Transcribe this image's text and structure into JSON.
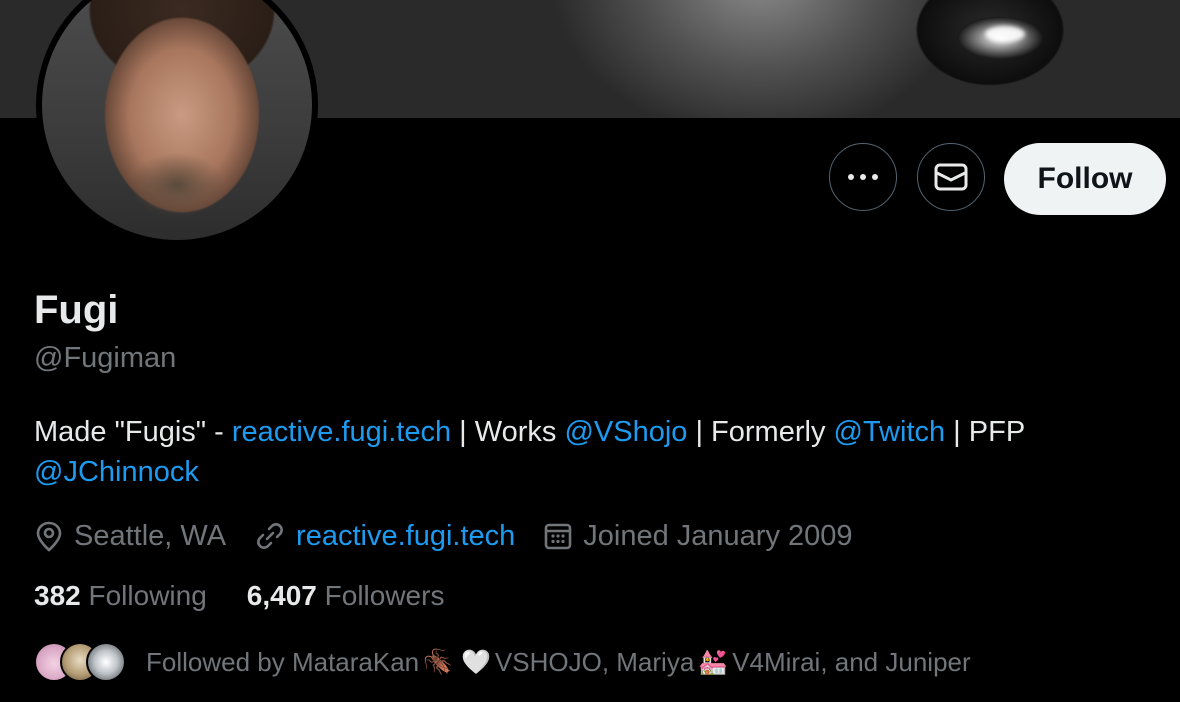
{
  "profile": {
    "name": "Fugi",
    "handle": "@Fugiman",
    "bio": {
      "t1": "Made \"Fugis\" - ",
      "l1": "reactive.fugi.tech",
      "t2": " | Works ",
      "l2": "@VShojo",
      "t3": " | Formerly ",
      "l3": "@Twitch",
      "t4": " | PFP ",
      "l4": "@JChinnock"
    },
    "location": "Seattle, WA",
    "website": "reactive.fugi.tech",
    "joined": "Joined January 2009",
    "following_count": "382",
    "following_label": "Following",
    "followers_count": "6,407",
    "followers_label": "Followers"
  },
  "actions": {
    "more_icon": "more-horizontal-icon",
    "message_icon": "envelope-icon",
    "follow_label": "Follow"
  },
  "followed_by": {
    "prefix": "Followed by MataraKan",
    "emoji1": "🪳",
    "emoji2": "🤍",
    "mid": "VSHOJO, Mariya",
    "emoji3": "💒",
    "suffix": "V4Mirai, and Juniper"
  },
  "colors": {
    "background": "#000000",
    "text": "#e7e9ea",
    "muted": "#71767b",
    "link": "#1d9bf0",
    "button_bg": "#eff3f4"
  }
}
